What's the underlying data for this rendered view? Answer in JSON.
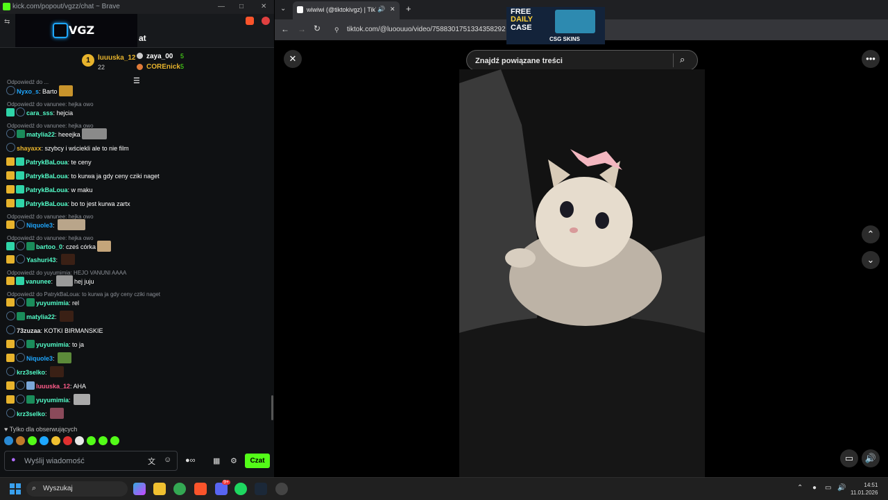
{
  "kick": {
    "window_title": "kick.com/popout/vgzz/chat ~ Brave",
    "brand": "VGZ",
    "chat_header": "at",
    "top_gifters": [
      {
        "rank": "1",
        "name": "luuuska_12",
        "count": "22"
      },
      {
        "name": "zaya_00",
        "count": "5"
      },
      {
        "name": "COREnick",
        "count": "5"
      }
    ],
    "messages": [
      {
        "reply": "Odpowiedź do ...",
        "user": "Nyxo_s",
        "text": "Barto"
      },
      {
        "reply": "Odpowiedź do vanunee: hejka owo",
        "user": "cara_sss",
        "text": "hejcia"
      },
      {
        "reply": "Odpowiedź do vanunee: hejka owo",
        "user": "matylia22",
        "text": "heeejka"
      },
      {
        "user": "shayaxx",
        "text": "szybcy i wściekli ale to nie film"
      },
      {
        "user": "PatrykBaLoua",
        "text": "te ceny"
      },
      {
        "user": "PatrykBaLoua",
        "text": "to kurwa ja gdy ceny cziki naget"
      },
      {
        "user": "PatrykBaLoua",
        "text": "w maku"
      },
      {
        "user": "PatrykBaLoua",
        "text": "bo to jest kurwa zartx"
      },
      {
        "reply": "Odpowiedź do vanunee: hejka owo",
        "user": "Niquole3",
        "text": ""
      },
      {
        "reply": "Odpowiedź do vanunee: hejka owo",
        "user": "bartoo_0",
        "text": "cześ córka"
      },
      {
        "user": "Yashuri43",
        "text": ""
      },
      {
        "reply": "Odpowiedź do yuyumimia: HEJO VANUNI AAAA",
        "user": "vanunee",
        "text": "hej juju"
      },
      {
        "reply": "Odpowiedź do PatrykBaLoua: to kurwa ja gdy ceny cziki naget",
        "user": "yuyumimia",
        "text": "rel"
      },
      {
        "user": "matylia22",
        "text": ""
      },
      {
        "user": "73zuzaa",
        "text": "KOTKI BIRMANSKIE"
      },
      {
        "user": "yuyumimia",
        "text": "to ja"
      },
      {
        "user": "Niquole3",
        "text": ""
      },
      {
        "user": "krz3selko",
        "text": ""
      },
      {
        "user": "luuuska_12",
        "text": "AHA"
      },
      {
        "user": "yuyumimia",
        "text": ""
      },
      {
        "user": "krz3selko",
        "text": ""
      }
    ],
    "follow_only": "Tylko dla obserwujących",
    "input_placeholder": "Wyślij wiadomość",
    "send_label": "Czat"
  },
  "browser": {
    "tab_title": "wiwiwi (@tiktokivgz) | TikTok",
    "url": "tiktok.com/@luoouuo/video/7588301751334358292",
    "search_placeholder": "Znajdź powiązane treści",
    "ad": {
      "line1": "FREE",
      "line2": "DAILY",
      "line3": "CASE",
      "brand": "CSG SKINS"
    }
  },
  "taskbar": {
    "search_label": "Wyszukaj",
    "time": "14:51",
    "date": "11.01.2026",
    "discord_badge": "9+"
  },
  "colors": {
    "kick_green": "#53fc18",
    "gold": "#e7b32c",
    "sub_teal": "#2fd4a8"
  }
}
